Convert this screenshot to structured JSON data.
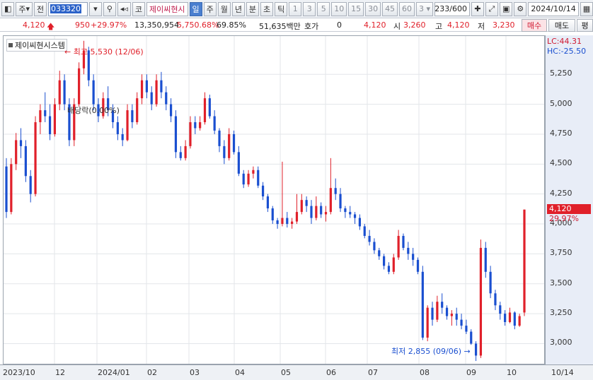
{
  "toolbar": {
    "market_label": "주",
    "prev_label": "전",
    "code": "033320",
    "name": "제이씨현시",
    "tabs": [
      "일",
      "주",
      "월",
      "년",
      "분",
      "초",
      "틱"
    ],
    "minute_periods": [
      "1",
      "3",
      "5",
      "10",
      "15",
      "30",
      "45",
      "60"
    ],
    "period_select": "3",
    "count": "233/600",
    "date": "2024/10/14"
  },
  "quote": {
    "price": "4,120",
    "change": "950",
    "change_pct": "+29.97%",
    "volume": "13,350,954",
    "volume_pct": "5,750.68%",
    "turnover": "69.85%",
    "amount": "51,635백만",
    "hoga_label": "호가",
    "hoga_value": "0",
    "ask_price": "4,120",
    "open_label": "시",
    "open": "3,260",
    "high_label": "고",
    "high": "4,120",
    "low_label": "저",
    "low": "3,230",
    "buy_label": "매수",
    "sell_label": "매도",
    "eval_label": "평"
  },
  "chart": {
    "legend": "제이씨현시스템",
    "lc_label": "LC:44.31",
    "hc_label": "HC:-25.50",
    "current_price_tag": "4,120",
    "current_pct_tag": "29.97%",
    "high_annotation": "최고 5,530 (12/06)",
    "low_annotation": "최저 2,855 (09/06)",
    "dividend_annotation": "배당락(0.00%)",
    "y_ticks": [
      "5,250",
      "5,000",
      "4,750",
      "4,500",
      "4,250",
      "4,000",
      "3,750",
      "3,500",
      "3,250",
      "3,000"
    ],
    "x_labels": [
      "2023/10",
      "12",
      "2024/01",
      "02",
      "03",
      "04",
      "05",
      "06",
      "07",
      "08",
      "09",
      "10",
      "10/14"
    ],
    "colors": {
      "up": "#e0202a",
      "down": "#1a4fd0"
    }
  },
  "chart_data": {
    "type": "candlestick",
    "title": "제이씨현시스템",
    "ylim": [
      2820,
      5570
    ],
    "series": [
      {
        "name": "제이씨현시스템",
        "ohlc": [
          [
            4480,
            4550,
            4050,
            4100
          ],
          [
            4100,
            4550,
            4080,
            4500
          ],
          [
            4500,
            4760,
            4450,
            4700
          ],
          [
            4700,
            4800,
            4550,
            4650
          ],
          [
            4650,
            4700,
            4350,
            4400
          ],
          [
            4400,
            4450,
            4180,
            4250
          ],
          [
            4250,
            4900,
            4230,
            4850
          ],
          [
            4850,
            5000,
            4750,
            4950
          ],
          [
            4950,
            5100,
            4850,
            4900
          ],
          [
            4900,
            5000,
            4700,
            4750
          ],
          [
            4750,
            5050,
            4730,
            5000
          ],
          [
            5000,
            5280,
            4950,
            5200
          ],
          [
            5200,
            5250,
            4950,
            5000
          ],
          [
            5000,
            5050,
            4650,
            4700
          ],
          [
            4700,
            5050,
            4650,
            5000
          ],
          [
            5000,
            5350,
            4980,
            5300
          ],
          [
            5300,
            5530,
            5250,
            5450
          ],
          [
            5450,
            5480,
            5150,
            5200
          ],
          [
            5200,
            5250,
            4950,
            5000
          ],
          [
            5000,
            5050,
            4850,
            4900
          ],
          [
            4900,
            5100,
            4880,
            5050
          ],
          [
            5050,
            5150,
            4900,
            4950
          ],
          [
            4950,
            5000,
            4800,
            4850
          ],
          [
            4850,
            4900,
            4700,
            4750
          ],
          [
            4750,
            4800,
            4650,
            4700
          ],
          [
            4700,
            5000,
            4690,
            4950
          ],
          [
            4950,
            5000,
            4800,
            4850
          ],
          [
            4850,
            5100,
            4830,
            5050
          ],
          [
            5050,
            5250,
            5000,
            5200
          ],
          [
            5200,
            5250,
            5050,
            5100
          ],
          [
            5100,
            5150,
            4950,
            5000
          ],
          [
            5000,
            5250,
            4980,
            5200
          ],
          [
            5200,
            5270,
            5050,
            5100
          ],
          [
            5100,
            5150,
            4950,
            5000
          ],
          [
            5000,
            5050,
            4850,
            4900
          ],
          [
            4900,
            4950,
            4550,
            4600
          ],
          [
            4600,
            4650,
            4530,
            4550
          ],
          [
            4550,
            4700,
            4530,
            4650
          ],
          [
            4650,
            4900,
            4630,
            4850
          ],
          [
            4850,
            4900,
            4750,
            4800
          ],
          [
            4800,
            4900,
            4780,
            4850
          ],
          [
            4850,
            5100,
            4830,
            5050
          ],
          [
            5050,
            5080,
            4880,
            4900
          ],
          [
            4900,
            4950,
            4750,
            4780
          ],
          [
            4780,
            4800,
            4600,
            4650
          ],
          [
            4650,
            4700,
            4500,
            4550
          ],
          [
            4550,
            4800,
            4530,
            4750
          ],
          [
            4750,
            4780,
            4580,
            4600
          ],
          [
            4600,
            4650,
            4400,
            4420
          ],
          [
            4420,
            4450,
            4300,
            4330
          ],
          [
            4330,
            4450,
            4310,
            4420
          ],
          [
            4420,
            4480,
            4380,
            4450
          ],
          [
            4450,
            4480,
            4300,
            4320
          ],
          [
            4320,
            4350,
            4200,
            4230
          ],
          [
            4230,
            4250,
            4100,
            4130
          ],
          [
            4130,
            4150,
            4000,
            4030
          ],
          [
            4030,
            4050,
            3960,
            4000
          ],
          [
            4000,
            4520,
            3980,
            4050
          ],
          [
            4050,
            4100,
            3970,
            4000
          ],
          [
            4000,
            4050,
            3960,
            4020
          ],
          [
            4020,
            4250,
            4000,
            4100
          ],
          [
            4100,
            4250,
            4080,
            4200
          ],
          [
            4200,
            4230,
            4100,
            4150
          ],
          [
            4150,
            4200,
            4000,
            4050
          ],
          [
            4050,
            4230,
            4030,
            4150
          ],
          [
            4150,
            4180,
            4050,
            4080
          ],
          [
            4080,
            4150,
            4020,
            4100
          ],
          [
            4100,
            4550,
            4080,
            4300
          ],
          [
            4300,
            4380,
            4200,
            4250
          ],
          [
            4250,
            4300,
            4100,
            4130
          ],
          [
            4130,
            4150,
            4050,
            4100
          ],
          [
            4100,
            4150,
            4050,
            4080
          ],
          [
            4080,
            4100,
            4000,
            4050
          ],
          [
            4050,
            4080,
            3950,
            3980
          ],
          [
            3980,
            4000,
            3880,
            3900
          ],
          [
            3900,
            3950,
            3820,
            3850
          ],
          [
            3850,
            3880,
            3750,
            3780
          ],
          [
            3780,
            3800,
            3700,
            3730
          ],
          [
            3730,
            3750,
            3620,
            3650
          ],
          [
            3650,
            3680,
            3580,
            3600
          ],
          [
            3600,
            3750,
            3580,
            3720
          ],
          [
            3720,
            3950,
            3700,
            3900
          ],
          [
            3900,
            3920,
            3780,
            3800
          ],
          [
            3800,
            3850,
            3700,
            3750
          ],
          [
            3750,
            3800,
            3650,
            3700
          ],
          [
            3700,
            3720,
            3580,
            3600
          ],
          [
            3600,
            3650,
            3030,
            3050
          ],
          [
            3050,
            3320,
            3020,
            3300
          ],
          [
            3300,
            3350,
            3150,
            3200
          ],
          [
            3200,
            3400,
            3180,
            3350
          ],
          [
            3350,
            3420,
            3250,
            3300
          ],
          [
            3300,
            3320,
            3200,
            3230
          ],
          [
            3230,
            3280,
            3150,
            3250
          ],
          [
            3250,
            3300,
            3150,
            3200
          ],
          [
            3200,
            3250,
            3120,
            3150
          ],
          [
            3150,
            3200,
            3080,
            3100
          ],
          [
            3100,
            3120,
            2990,
            3000
          ],
          [
            3000,
            3020,
            2855,
            2900
          ],
          [
            2900,
            3870,
            2880,
            3800
          ],
          [
            3800,
            3850,
            3550,
            3600
          ],
          [
            3600,
            3650,
            3380,
            3420
          ],
          [
            3420,
            3450,
            3280,
            3320
          ],
          [
            3320,
            3350,
            3200,
            3250
          ],
          [
            3250,
            3280,
            3150,
            3180
          ],
          [
            3180,
            3300,
            3170,
            3260
          ],
          [
            3260,
            3270,
            3120,
            3150
          ],
          [
            3150,
            3250,
            3140,
            3230
          ],
          [
            3260,
            4120,
            3230,
            4120
          ]
        ]
      }
    ]
  }
}
